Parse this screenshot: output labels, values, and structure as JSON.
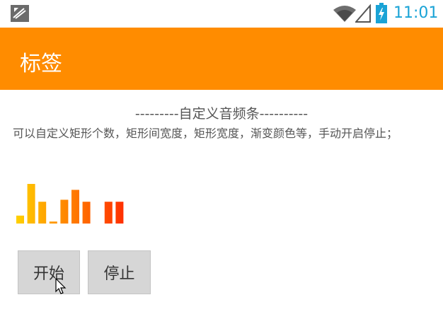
{
  "status_bar": {
    "time": "11:01",
    "notification_icon": "debug-notification-icon",
    "wifi_icon": "wifi-icon",
    "signal_icon": "cell-signal-icon",
    "battery_icon": "battery-charging-icon",
    "time_color": "#1aa3d6"
  },
  "action_bar": {
    "title": "标签",
    "color": "#ff8c00"
  },
  "content": {
    "heading": "---------自定义音频条----------",
    "description": "可以自定义矩形个数，矩形间宽度，矩形宽度，渐变颜色等，手动开启停止；",
    "audio_bar_levels": [
      0.2,
      1.0,
      0.55,
      0.05,
      0.6,
      0.85,
      0.55,
      0.0,
      0.55,
      0.55
    ],
    "gradient_start_color": "#ffd400",
    "gradient_end_color": "#ff2a00"
  },
  "buttons": {
    "start": "开始",
    "stop": "停止"
  }
}
